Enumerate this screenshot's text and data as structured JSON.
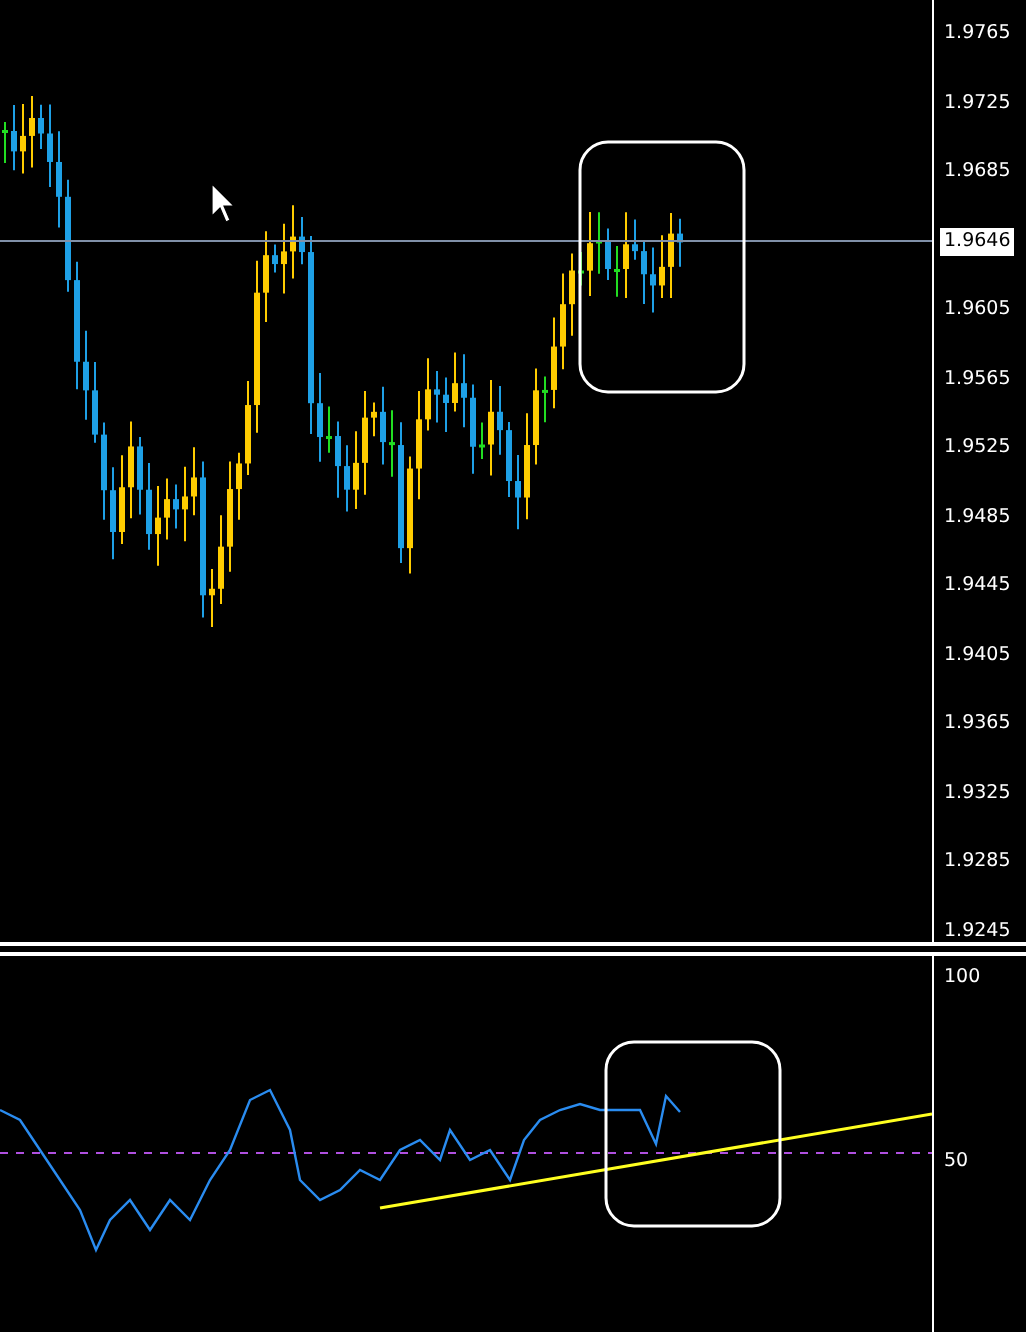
{
  "price_axis": {
    "ticks": [
      {
        "label": "1.9765",
        "kind": "tick"
      },
      {
        "label": "1.9725",
        "kind": "tick"
      },
      {
        "label": "1.9685",
        "kind": "tick"
      },
      {
        "label": "1.9646",
        "kind": "current"
      },
      {
        "label": "1.9605",
        "kind": "tick"
      },
      {
        "label": "1.9565",
        "kind": "tick"
      },
      {
        "label": "1.9525",
        "kind": "tick"
      },
      {
        "label": "1.9485",
        "kind": "tick"
      },
      {
        "label": "1.9445",
        "kind": "tick"
      },
      {
        "label": "1.9405",
        "kind": "tick"
      },
      {
        "label": "1.9365",
        "kind": "tick"
      },
      {
        "label": "1.9325",
        "kind": "tick"
      },
      {
        "label": "1.9285",
        "kind": "tick"
      },
      {
        "label": "1.9245",
        "kind": "tick"
      }
    ]
  },
  "indicator_axis": {
    "ticks": [
      {
        "label": "100"
      },
      {
        "label": "50"
      }
    ]
  }
}
